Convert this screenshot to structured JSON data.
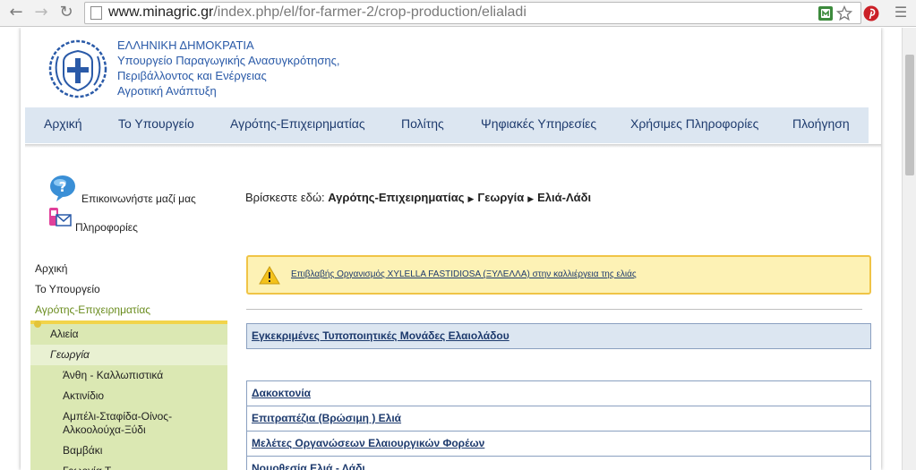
{
  "browser": {
    "url_domain": "www.minagric.gr",
    "url_path": "/index.php/el/for-farmer-2/crop-production/elialadi"
  },
  "header": {
    "line1": "ΕΛΛΗΝΙΚΗ ΔΗΜΟΚΡΑΤΙΑ",
    "line2": "Υπουργείο Παραγωγικής Ανασυγκρότησης,",
    "line3": "Περιβάλλοντος και Ενέργειας",
    "line4": "Αγροτική Ανάπτυξη"
  },
  "menu": [
    "Αρχική",
    "Το Υπουργείο",
    "Αγρότης-Επιχειρηματίας",
    "Πολίτης",
    "Ψηφιακές Υπηρεσίες",
    "Χρήσιμες Πληροφορίες",
    "Πλοήγηση"
  ],
  "contact": {
    "contact_label": "Επικοινωνήστε μαζί μας",
    "info_label": "Πληροφορίες"
  },
  "left_nav": {
    "top_items": [
      "Αρχική",
      "Το Υπουργείο",
      "Αγρότης-Επιχειρηματίας"
    ],
    "sub_items": [
      "Αλιεία",
      "Γεωργία"
    ],
    "subsub_items": [
      "Άνθη - Καλλωπιστικά",
      "Ακτινίδιο",
      "Αμπέλι-Σταφίδα-Οίνος-\nΑλκοολούχα-Ξύδι",
      "Βαμβάκι",
      "Γεωργία Τ..."
    ]
  },
  "breadcrumb": {
    "prefix": "Βρίσκεστε εδώ:",
    "level1": "Αγρότης-Επιχειρηματίας",
    "level2": "Γεωργία",
    "level3": "Ελιά-Λάδι"
  },
  "alert": {
    "text": "Επιβλαβής Οργανισμός XYLELLA FASTIDIOSA (ΞΥΛΕΛΛΑ) στην καλλιέργεια της ελιάς"
  },
  "approved_link": "Εγκεκριμένες Τυποποιητικές Μονάδες Ελαιολάδου",
  "links": [
    "Δακοκτονία",
    "Επιτραπέζια (Βρώσιμη ) Ελιά",
    "Μελέτες Οργανώσεων Ελαιουργικών Φορέων",
    "Νομοθεσία Ελιά - Λάδι"
  ],
  "colors": {
    "menu_bg": "#dce6f1",
    "subnav_bg": "#dbe8b3",
    "alert_bg": "#fdf2b5",
    "link": "#1d3a6d",
    "brand_blue": "#2a5aa8",
    "active_green": "#6a8c1e"
  }
}
